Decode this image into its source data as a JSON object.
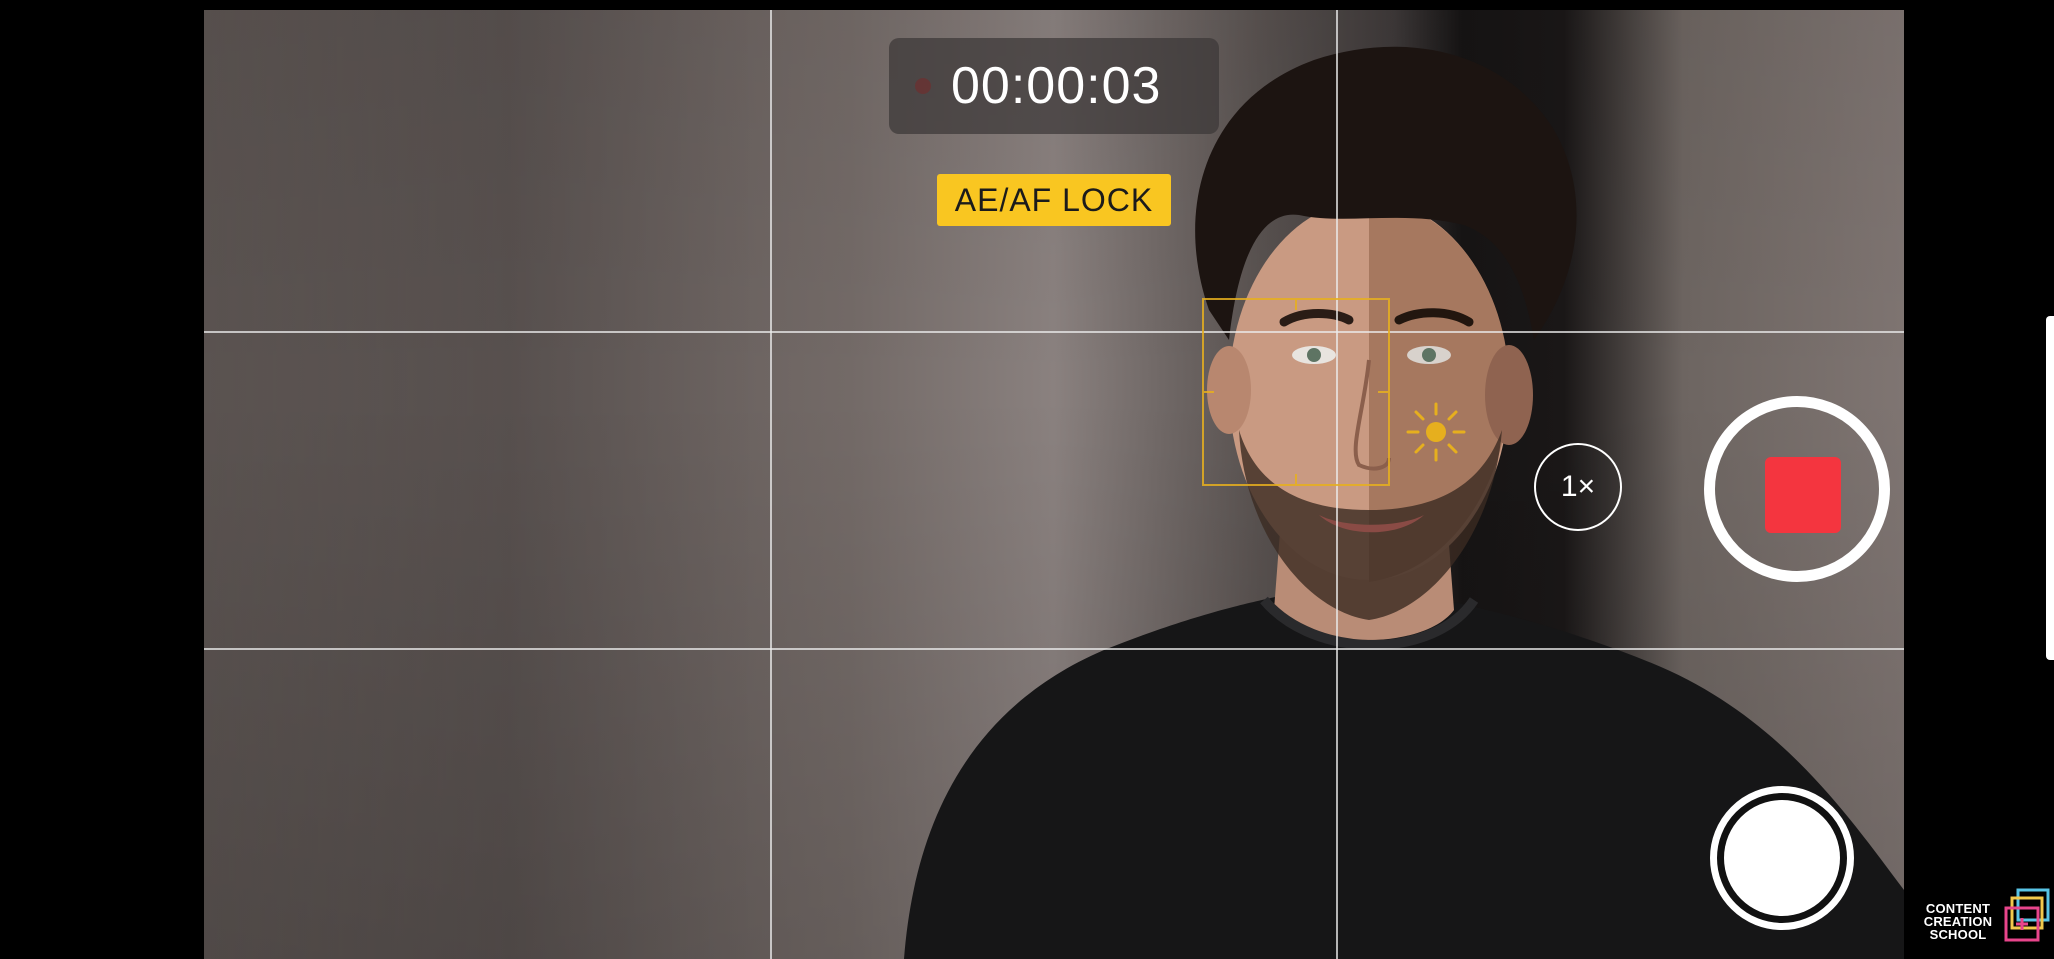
{
  "recording": {
    "timer": "00:00:03",
    "lock_label": "AE/AF LOCK"
  },
  "controls": {
    "zoom_label": "1×",
    "record_button": "stop-recording",
    "shutter_button": "capture-still"
  },
  "watermark": {
    "line1": "CONTENT",
    "line2": "CREATION",
    "line3": "SCHOOL"
  },
  "colors": {
    "lock_badge": "#f9c621",
    "focus_box": "#e6af1e",
    "record_stop": "#f4353f"
  },
  "icons": {
    "exposure": "sun-icon",
    "recording_indicator": "record-dot-icon",
    "watermark_logo": "content-creation-school-logo"
  }
}
